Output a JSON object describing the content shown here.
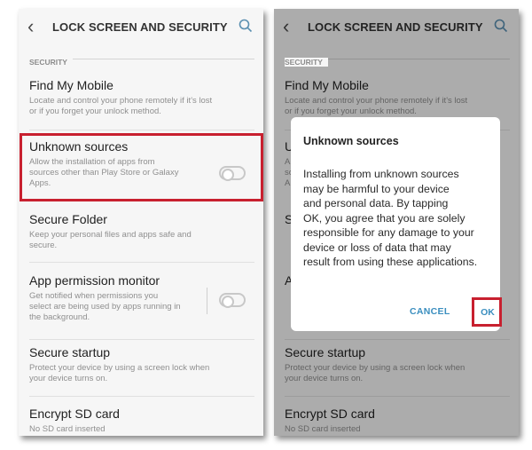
{
  "header": {
    "title": "LOCK SCREEN AND SECURITY"
  },
  "section_label": "SECURITY",
  "items": {
    "find_my_mobile": {
      "title": "Find My Mobile",
      "desc": "Locate and control your phone remotely if it's lost\nor if you forget your unlock method."
    },
    "unknown_sources": {
      "title": "Unknown sources",
      "desc": "Allow the installation of apps from\nsources other than Play Store or Galaxy\nApps.",
      "toggle": "off"
    },
    "secure_folder": {
      "title": "Secure Folder",
      "desc": "Keep your personal files and apps safe and\nsecure."
    },
    "app_permission_monitor": {
      "title": "App permission monitor",
      "desc": "Get notified when permissions you\nselect are being used by apps running in\nthe background.",
      "toggle": "off"
    },
    "secure_startup": {
      "title": "Secure startup",
      "desc": "Protect your device by using a screen lock when\nyour device turns on."
    },
    "encrypt_sd": {
      "title": "Encrypt SD card",
      "desc": "No SD card inserted"
    }
  },
  "dialog": {
    "title": "Unknown sources",
    "body": "Installing from unknown sources\nmay be harmful to your device\nand personal data. By tapping\nOK, you agree that you are solely\nresponsible for any damage to your\ndevice or loss of data that may\nresult from using these applications.",
    "cancel_label": "CANCEL",
    "ok_label": "OK"
  },
  "colors": {
    "highlight": "#c8202f",
    "accent": "#3a8ebf"
  },
  "icons": {
    "back": "chevron-left-icon",
    "search": "search-icon"
  }
}
